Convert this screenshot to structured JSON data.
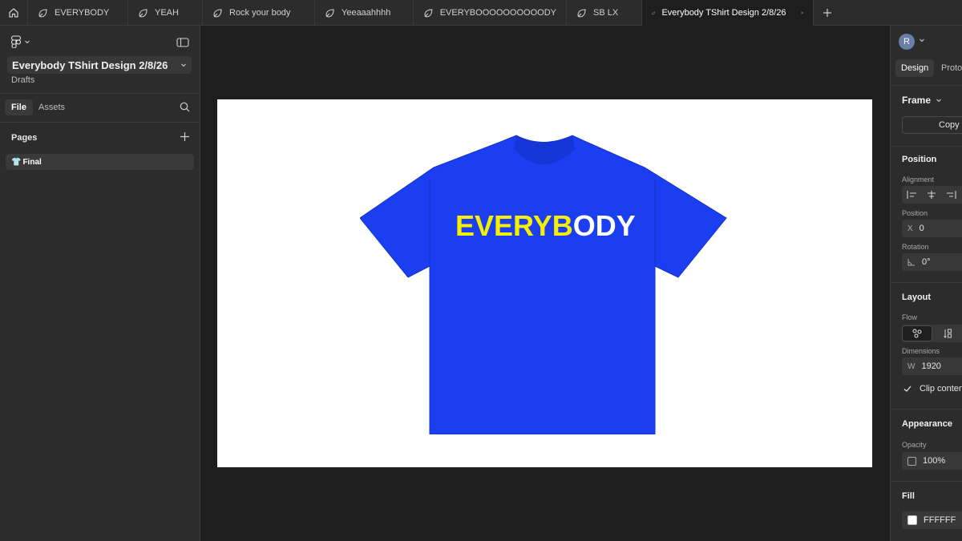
{
  "tabs": [
    {
      "label": "EVERYBODY"
    },
    {
      "label": "YEAH"
    },
    {
      "label": "Rock your body"
    },
    {
      "label": "Yeeaaahhhh"
    },
    {
      "label": "EVERYBOOOOOOOOOODY"
    },
    {
      "label": "SB LX"
    },
    {
      "label": "Everybody TShirt Design 2/8/26"
    }
  ],
  "left_panel": {
    "file_title": "Everybody TShirt Design 2/8/26",
    "location": "Drafts",
    "tab_file": "File",
    "tab_assets": "Assets",
    "pages_label": "Pages",
    "pages": [
      {
        "emoji": "👕",
        "label": "Final"
      }
    ]
  },
  "canvas": {
    "frame_bg": "#FFFFFF",
    "shirt_color": "#1b3ef0",
    "shirt_text_part1": "EVERYB",
    "shirt_text_part2": "ODY",
    "text_color_1": "#f5ef00",
    "text_color_2": "#ffffff"
  },
  "right_panel": {
    "avatar_initial": "R",
    "tab_design": "Design",
    "tab_prototype": "Proto",
    "frame_label": "Frame",
    "copy_button": "Copy t",
    "position_title": "Position",
    "alignment_label": "Alignment",
    "position_label": "Position",
    "x_prefix": "X",
    "x_value": "0",
    "rotation_label": "Rotation",
    "rotation_value": "0°",
    "layout_title": "Layout",
    "flow_label": "Flow",
    "dimensions_label": "Dimensions",
    "w_prefix": "W",
    "w_value": "1920",
    "clip_content_label": "Clip content",
    "appearance_title": "Appearance",
    "opacity_label": "Opacity",
    "opacity_value": "100%",
    "fill_title": "Fill",
    "fill_value": "FFFFFF"
  }
}
